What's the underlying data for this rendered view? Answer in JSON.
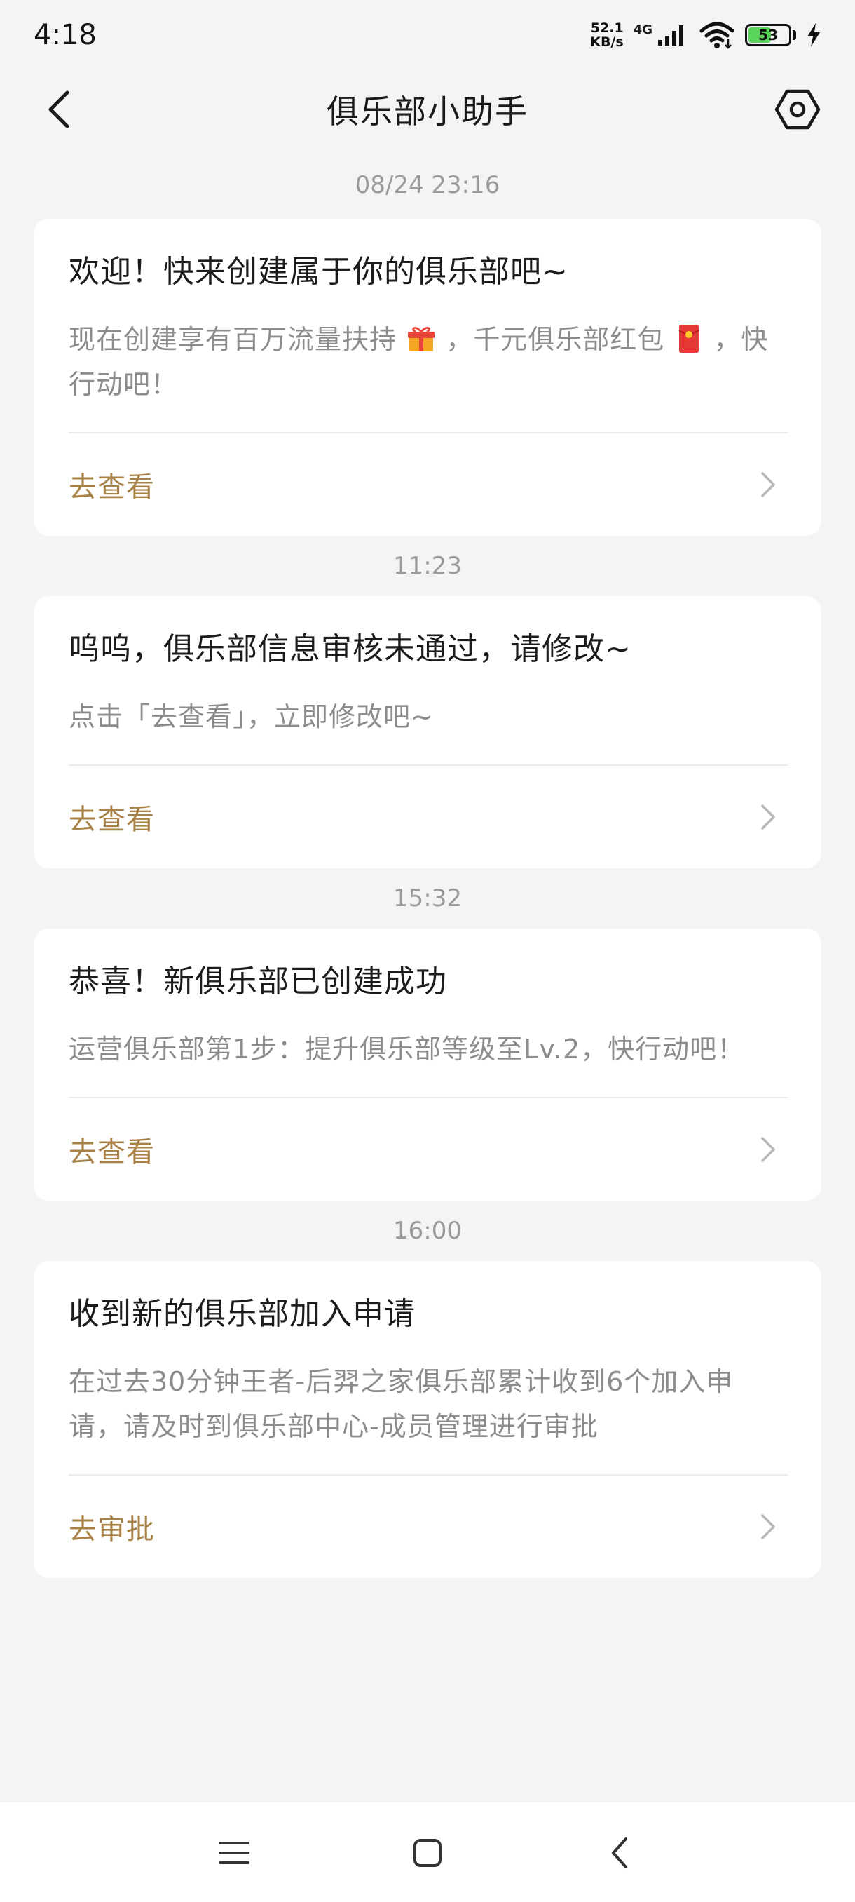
{
  "status_bar": {
    "time": "4:18",
    "net_speed_value": "52.1",
    "net_speed_unit": "KB/s",
    "net_type": "4G",
    "battery_level": "53",
    "battery_fraction": 0.53,
    "battery_color": "#5bd45b"
  },
  "header": {
    "title": "俱乐部小助手"
  },
  "colors": {
    "accent": "#a88147",
    "background": "#f4f4f6",
    "card": "#ffffff"
  },
  "messages": [
    {
      "time": "08/24 23:16",
      "title": "欢迎！快来创建属于你的俱乐部吧~",
      "body_part1": "现在创建享有百万流量扶持",
      "body_part2": "，千元俱乐部红包",
      "body_part3": "，快行动吧！",
      "action": "去查看",
      "icons": [
        "gift-emoji-icon",
        "red-envelope-emoji-icon"
      ]
    },
    {
      "time": "11:23",
      "title": "呜呜，俱乐部信息审核未通过，请修改~",
      "body": "点击「去查看」，立即修改吧~",
      "action": "去查看"
    },
    {
      "time": "15:32",
      "title": "恭喜！新俱乐部已创建成功",
      "body": "运营俱乐部第1步：提升俱乐部等级至Lv.2，快行动吧！",
      "action": "去查看"
    },
    {
      "time": "16:00",
      "title": "收到新的俱乐部加入申请",
      "body": "在过去30分钟王者-后羿之家俱乐部累计收到6个加入申请，请及时到俱乐部中心-成员管理进行审批",
      "action": "去审批"
    }
  ]
}
